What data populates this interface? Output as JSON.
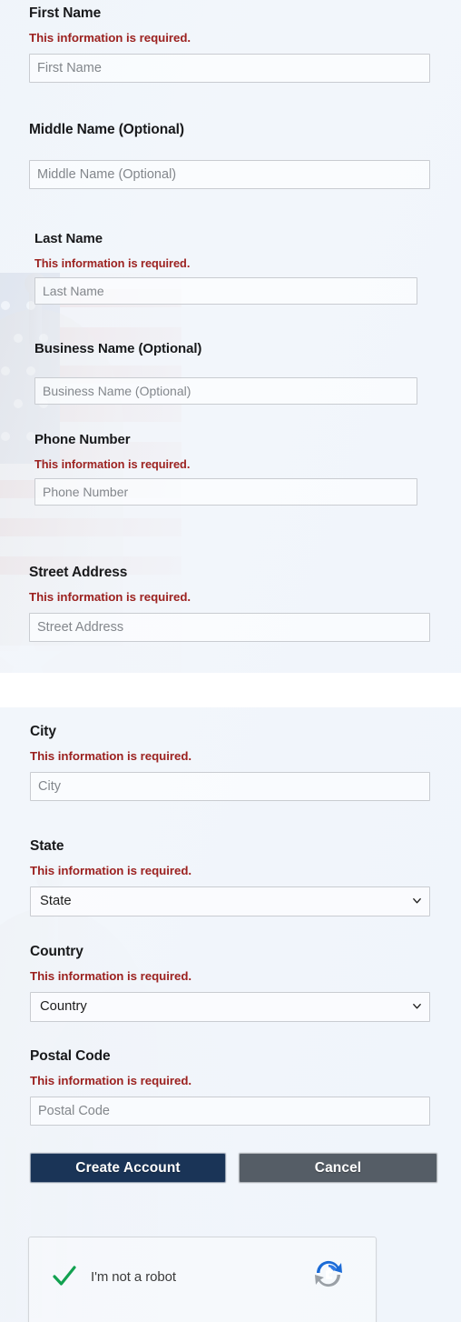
{
  "theme": {
    "page_background": "#f1f5fa",
    "error_color": "#9c2220",
    "label_color": "#18191b",
    "input_border": "#c9ccd1",
    "placeholder_color": "#83878c",
    "primary_button_color": "#1a3457",
    "secondary_button_color": "#555d66",
    "check_color": "#12a150",
    "recaptcha_blue": "#1b6bd6",
    "recaptcha_gray": "#9aa0a6"
  },
  "form": {
    "required_message": "This information is required.",
    "fields": [
      {
        "name": "first-name",
        "label": "First Name",
        "error": "This information is required.",
        "placeholder": "First Name",
        "value": "",
        "type": "text"
      },
      {
        "name": "middle-name",
        "label": "Middle Name (Optional)",
        "error": "",
        "placeholder": "Middle Name (Optional)",
        "value": "",
        "type": "text"
      },
      {
        "name": "last-name",
        "label": "Last Name",
        "error": "This information is required.",
        "placeholder": "Last Name",
        "value": "",
        "type": "text"
      },
      {
        "name": "business-name",
        "label": "Business Name (Optional)",
        "error": "",
        "placeholder": "Business Name (Optional)",
        "value": "",
        "type": "text"
      },
      {
        "name": "phone-number",
        "label": "Phone Number",
        "error": "This information is required.",
        "placeholder": "Phone Number",
        "value": "",
        "type": "tel"
      },
      {
        "name": "street-address",
        "label": "Street Address",
        "error": "This information is required.",
        "placeholder": "Street Address",
        "value": "",
        "type": "text"
      },
      {
        "name": "city",
        "label": "City",
        "error": "This information is required.",
        "placeholder": "City",
        "value": "",
        "type": "text"
      },
      {
        "name": "state",
        "label": "State",
        "error": "This information is required.",
        "selected": "State",
        "value": "State",
        "type": "select"
      },
      {
        "name": "country",
        "label": "Country",
        "error": "This information is required.",
        "selected": "Country",
        "value": "Country",
        "type": "select"
      },
      {
        "name": "postal-code",
        "label": "Postal Code",
        "error": "This information is required.",
        "placeholder": "Postal Code",
        "value": "",
        "type": "text"
      }
    ]
  },
  "actions": {
    "create_account_label": "Create Account",
    "cancel_label": "Cancel"
  },
  "recaptcha": {
    "label": "I'm not a robot",
    "checked": true,
    "logo_icon": "recaptcha-logo-icon",
    "check_icon": "green-checkmark-icon"
  }
}
